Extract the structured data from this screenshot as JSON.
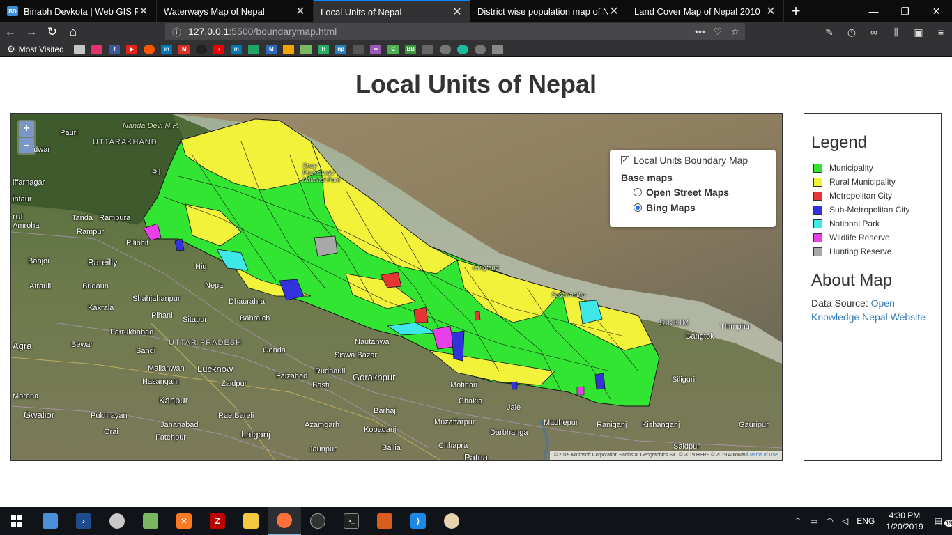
{
  "browser": {
    "tabs": [
      {
        "favicon": "BD",
        "title": "Binabh Devkota | Web GIS Proje",
        "active": false
      },
      {
        "favicon": "",
        "title": "Waterways Map of Nepal",
        "active": false
      },
      {
        "favicon": "",
        "title": "Local Units of Nepal",
        "active": true
      },
      {
        "favicon": "",
        "title": "District wise population map of Ne",
        "active": false
      },
      {
        "favicon": "",
        "title": "Land Cover Map of Nepal 2010",
        "active": false
      }
    ],
    "url_host": "127.0.0.1",
    "url_path": ":5500/boundarymap.html",
    "bookmarks_label": "Most Visited"
  },
  "page": {
    "title": "Local Units of Nepal"
  },
  "map": {
    "zoom_in": "+",
    "zoom_out": "–",
    "layer_control": {
      "overlay_label": "Local Units Boundary Map",
      "overlay_checked": true,
      "base_heading": "Base maps",
      "base_layers": [
        {
          "label": "Open Street Maps",
          "selected": false
        },
        {
          "label": "Bing Maps",
          "selected": true
        }
      ]
    },
    "attribution": "© 2019 Microsoft Corporation Earthstar Geographics SIO © 2019 HERE © 2019 AutoNavi",
    "attribution_link": "Terms of Use",
    "place_labels": {
      "nanda_devi": "Nanda Devi N.P.",
      "pauri": "Pauri",
      "uttarakhand": "UTTARAKHAND",
      "haridwar": "Haridwar",
      "muzaffarnagar": "iffarnagar",
      "shahtaur": "ihtaur",
      "rudrapur": "rut",
      "amroha": "Amroha",
      "tanda": "Tanda",
      "rampura": "Rampura",
      "rampur": "Rampur",
      "pilibhit": "Pilibhit",
      "pil": "Pil",
      "bahjoi": "Bahjoi",
      "bareilly": "Bareilly",
      "atrauli": "Atrauli",
      "budaun": "Budaun",
      "shahjahanpur": "Shahjahanpur",
      "kakrala": "Kakrala",
      "pihani": "Pihani",
      "sitapur": "Sitapur",
      "bahraich": "Bahraich",
      "dhaurahra": "Dhaurahra",
      "farrukhabad": "Farrukhabad",
      "agra": "Agra",
      "bewar": "Bewar",
      "sandi": "Sandi",
      "uttar_pradesh": "UTTAR PRADESH",
      "gonda": "Gonda",
      "mallanwan": "Mallanwan",
      "lucknow": "Lucknow",
      "hasanganj": "Hasanganj",
      "zaidpur": "Zaidpur",
      "faizabad": "Faizabad",
      "rudhauli": "Rudhauli",
      "basti": "Basti",
      "gorakhpur": "Gorakhpur",
      "siswa_bazar": "Siswa Bazar",
      "nautanwa": "Nautanwa",
      "kanpur": "Kanpur",
      "morena": "Morena",
      "gwalior": "Gwalior",
      "pukhrayan": "Pukhrayan",
      "jahanabad": "Jahanabad",
      "fatehpur": "Fatehpur",
      "orai": "Orai",
      "rae_bareli": "Rae Bareli",
      "lalganj": "Lalganj",
      "azamgarh": "Azamgarh",
      "jaunpur": "Jaunpur",
      "barhaj": "Barhaj",
      "kopaganj": "Kopaganj",
      "ballia": "Ballia",
      "chhapra": "Chhapra",
      "patna": "Patna",
      "muzaffarpur": "Muzaffarpur",
      "chakia": "Chakia",
      "motihari": "Motihari",
      "jale": "Jale",
      "darbhanga": "Darbhanga",
      "madhepur": "Madhepur",
      "raniganj": "Raniganj",
      "kishanganj": "Kishanganj",
      "gauripur": "Gauripur",
      "saidpur": "Saidpur",
      "siliguri": "Siliguri",
      "gangtok": "Gangtok",
      "sikkim": "SIKKIM",
      "thimphu": "Thimphu",
      "langtang": "Langtang",
      "sagarmatha": "Sagarmatha",
      "shey_phoksundo": "Shey Phoksundo National Park",
      "nig": "Nig",
      "nepa": "Nepa"
    }
  },
  "legend": {
    "title": "Legend",
    "items": [
      {
        "label": "Municipality",
        "color": "#33e533"
      },
      {
        "label": "Rural Municipality",
        "color": "#f2f23a"
      },
      {
        "label": "Metropolitan City",
        "color": "#e53535"
      },
      {
        "label": "Sub-Metropolitan City",
        "color": "#3333dd"
      },
      {
        "label": "National Park",
        "color": "#3fe8e8"
      },
      {
        "label": "Wildlife Reserve",
        "color": "#e83fe8"
      },
      {
        "label": "Hunting Reserve",
        "color": "#a8a8a8"
      }
    ]
  },
  "about": {
    "title": "About Map",
    "source_label": "Data Source: ",
    "source_link": "Open Knowledge Nepal Website"
  },
  "taskbar": {
    "time": "4:30 PM",
    "date": "1/20/2019",
    "lang": "ENG",
    "notifications": "19"
  }
}
